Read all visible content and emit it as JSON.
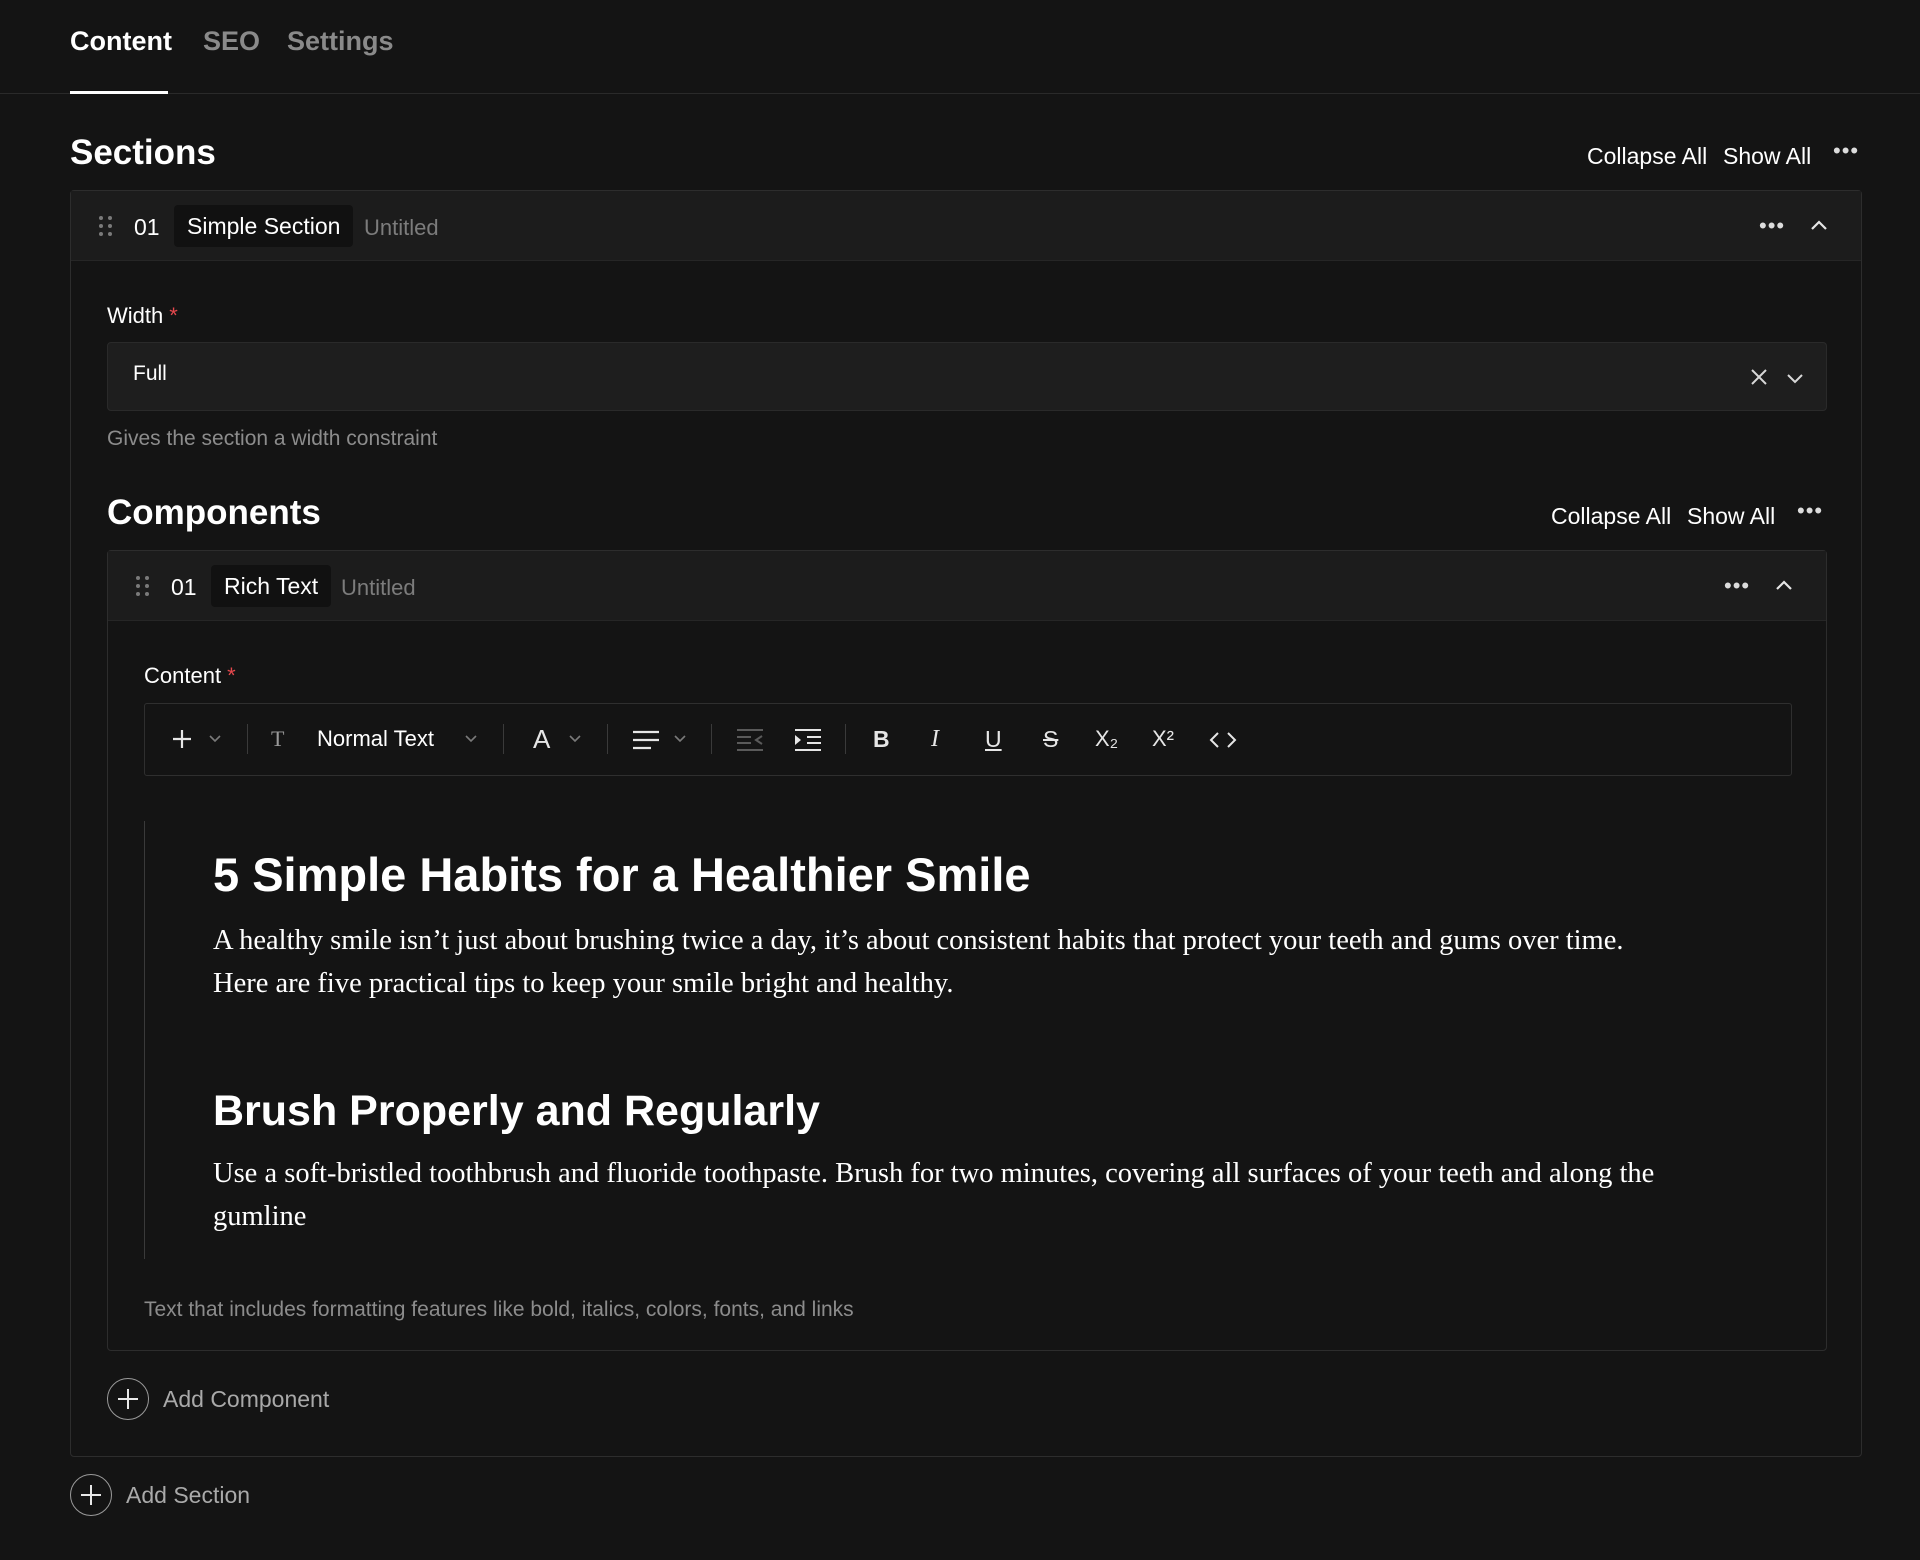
{
  "tabs": [
    {
      "label": "Content",
      "active": true
    },
    {
      "label": "SEO",
      "active": false
    },
    {
      "label": "Settings",
      "active": false
    }
  ],
  "sections": {
    "title": "Sections",
    "collapse_all": "Collapse All",
    "show_all": "Show All",
    "items": [
      {
        "index": "01",
        "type": "Simple Section",
        "name": "Untitled",
        "width_field": {
          "label": "Width",
          "value": "Full",
          "help": "Gives the section a width constraint"
        },
        "components": {
          "title": "Components",
          "collapse_all": "Collapse All",
          "show_all": "Show All",
          "items": [
            {
              "index": "01",
              "type": "Rich Text",
              "name": "Untitled",
              "content_field": {
                "label": "Content",
                "toolbar": {
                  "text_style": "Normal Text",
                  "buttons": [
                    "add",
                    "text-style",
                    "font-color",
                    "align",
                    "outdent",
                    "indent",
                    "bold",
                    "italic",
                    "underline",
                    "strikethrough",
                    "subscript",
                    "superscript",
                    "code"
                  ]
                },
                "document": {
                  "h1": "5 Simple Habits for a Healthier Smile",
                  "p1_line1": "A healthy smile isn’t just about brushing twice a day, it’s about consistent habits that protect your teeth and gums over time.",
                  "p1_line2": "Here are five practical tips to keep your smile bright and healthy.",
                  "h2": "Brush Properly and Regularly",
                  "p2_line1": "Use a soft-bristled toothbrush and fluoride toothpaste. Brush for two minutes, covering all surfaces of your teeth and along the",
                  "p2_line2": "gumline"
                },
                "help": "Text that includes formatting features like bold, italics, colors, fonts, and links"
              }
            }
          ],
          "add_label": "Add Component"
        }
      }
    ],
    "add_label": "Add Section"
  },
  "toolbar_glyphs": {
    "bold": "B",
    "italic": "I",
    "underline": "U",
    "strike": "S",
    "sub": "X₂",
    "sup": "X²",
    "text_style_icon": "T",
    "font": "A"
  }
}
